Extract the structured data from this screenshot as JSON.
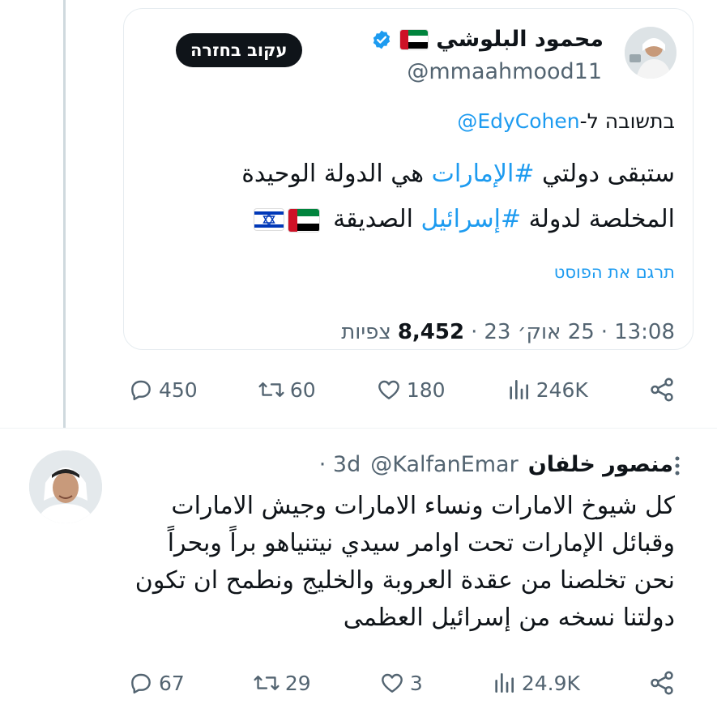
{
  "quoted": {
    "display_name": "محمود البلوشي",
    "handle": "@mmaahmood11",
    "follow_button": "עקוב בחזרה",
    "reply_prefix": "בתשובה ל-",
    "reply_mention": "@EdyCohen",
    "line1_start": "ستبقى دولتي ",
    "line1_tag": "#الإمارات",
    "line1_end": " هي الدولة الوحيدة",
    "line2_start": "المخلصة لدولة ",
    "line2_tag": "#إسرائيل",
    "line2_end": " الصديقة",
    "translate": "תרגם את הפוסט",
    "time": "13:08",
    "date": "25 אוק׳ 23",
    "views_count": "8,452",
    "views_label": "צפיות",
    "sep": "·",
    "flag_icons": [
      "uae-flag-icon",
      "israel-flag-icon"
    ]
  },
  "quoted_actions": {
    "replies": "450",
    "reposts": "60",
    "likes": "180",
    "views": "246K"
  },
  "reply_tweet": {
    "display_name": "منصور خلفان",
    "handle": "@KalfanEmar",
    "age": "· 3d",
    "lines": [
      "كل شيوخ الامارات ونساء الامارات وجيش الامارات",
      "وقبائل الإمارات تحت اوامر سيدي نيتنياهو براً وبحراً",
      "نحن تخلصنا من عقدة العروبة والخليج ونطمح ان تكون",
      "دولتنا نسخه من إسرائيل العظمى"
    ]
  },
  "reply_actions": {
    "replies": "67",
    "reposts": "29",
    "likes": "3",
    "views": "24.9K"
  },
  "colors": {
    "accent": "#1d9bf0",
    "text": "#0f1419",
    "muted": "#536471"
  }
}
